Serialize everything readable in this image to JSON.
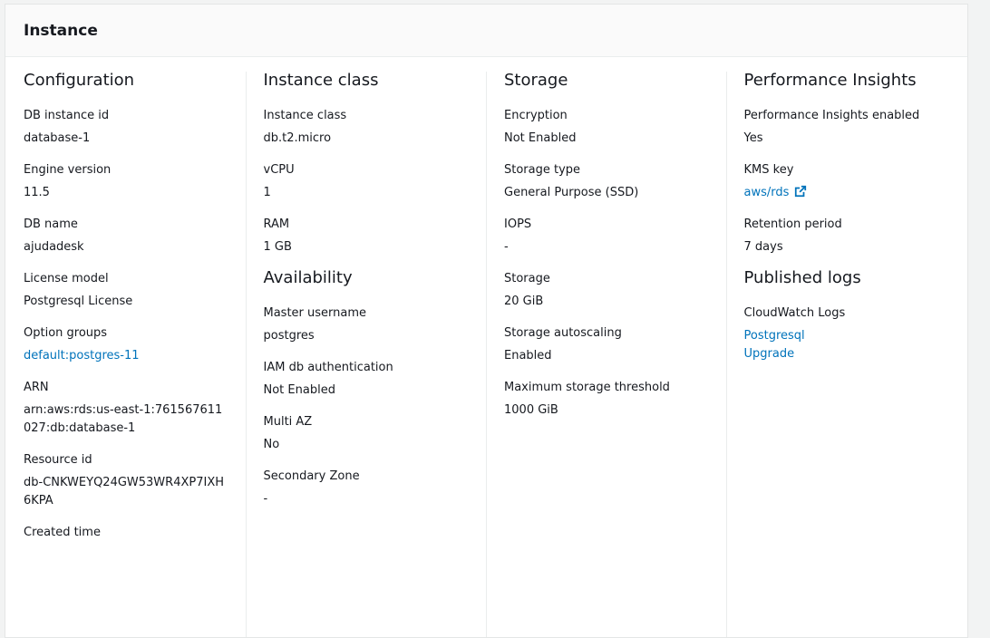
{
  "panel": {
    "title": "Instance"
  },
  "configuration": {
    "title": "Configuration",
    "fields": {
      "db_instance_id": {
        "label": "DB instance id",
        "value": "database-1"
      },
      "engine_version": {
        "label": "Engine version",
        "value": "11.5"
      },
      "db_name": {
        "label": "DB name",
        "value": "ajudadesk"
      },
      "license_model": {
        "label": "License model",
        "value": "Postgresql License"
      },
      "option_groups": {
        "label": "Option groups",
        "value": "default:postgres-11"
      },
      "arn": {
        "label": "ARN",
        "value": "arn:aws:rds:us-east-1:761567611027:db:database-1"
      },
      "resource_id": {
        "label": "Resource id",
        "value": "db-CNKWEYQ24GW53WR4XP7IXH6KPA"
      },
      "created_time": {
        "label": "Created time"
      }
    }
  },
  "instance_class": {
    "title": "Instance class",
    "fields": {
      "instance_class": {
        "label": "Instance class",
        "value": "db.t2.micro"
      },
      "vcpu": {
        "label": "vCPU",
        "value": "1"
      },
      "ram": {
        "label": "RAM",
        "value": "1 GB"
      }
    }
  },
  "availability": {
    "title": "Availability",
    "fields": {
      "master_username": {
        "label": "Master username",
        "value": "postgres"
      },
      "iam_db_auth": {
        "label": "IAM db authentication",
        "value": "Not Enabled"
      },
      "multi_az": {
        "label": "Multi AZ",
        "value": "No"
      },
      "secondary_zone": {
        "label": "Secondary Zone",
        "value": "-"
      }
    }
  },
  "storage": {
    "title": "Storage",
    "fields": {
      "encryption": {
        "label": "Encryption",
        "value": "Not Enabled"
      },
      "storage_type": {
        "label": "Storage type",
        "value": "General Purpose (SSD)"
      },
      "iops": {
        "label": "IOPS",
        "value": "-"
      },
      "storage": {
        "label": "Storage",
        "value": "20 GiB"
      },
      "storage_autoscaling": {
        "label": "Storage autoscaling",
        "value": "Enabled"
      },
      "max_storage_threshold": {
        "label": "Maximum storage threshold",
        "value": "1000 GiB"
      }
    }
  },
  "performance_insights": {
    "title": "Performance Insights",
    "fields": {
      "enabled": {
        "label": "Performance Insights enabled",
        "value": "Yes"
      },
      "kms_key": {
        "label": "KMS key",
        "value": "aws/rds",
        "icon": "external-link-icon"
      },
      "retention_period": {
        "label": "Retention period",
        "value": "7 days"
      }
    }
  },
  "published_logs": {
    "title": "Published logs",
    "fields": {
      "cloudwatch_logs": {
        "label": "CloudWatch Logs",
        "links": [
          "Postgresql",
          "Upgrade"
        ]
      }
    }
  },
  "colors": {
    "link": "#0073bb",
    "text": "#16191f",
    "divider": "#eaeded"
  }
}
